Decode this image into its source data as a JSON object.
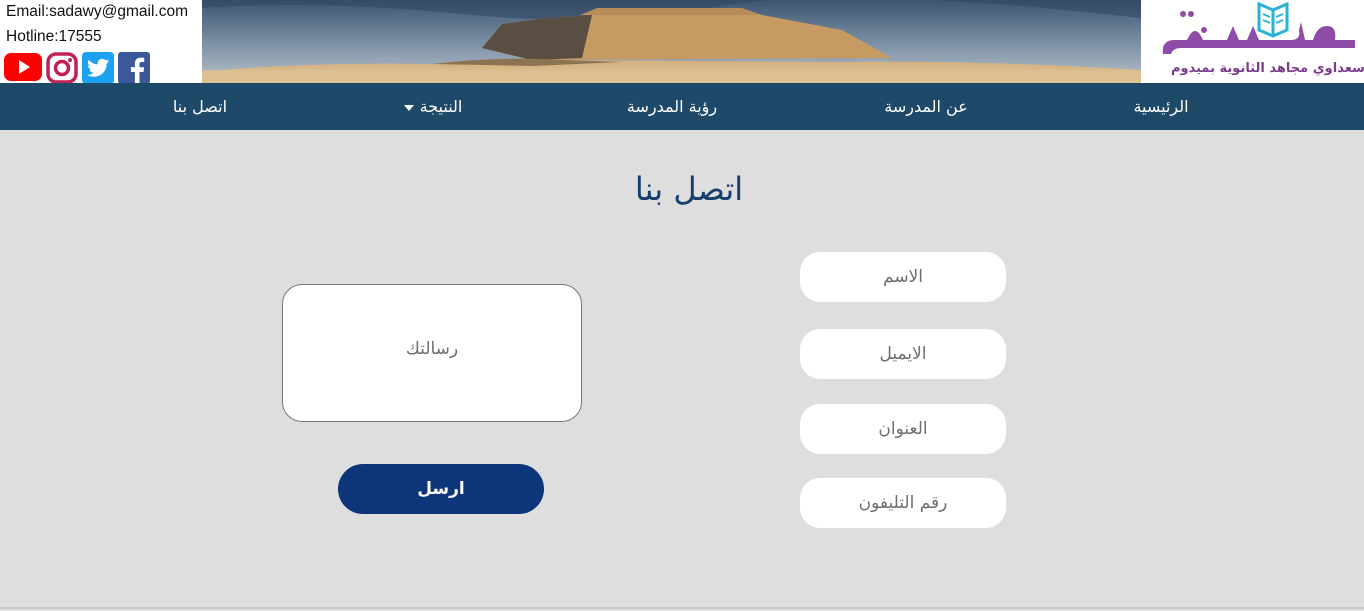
{
  "header": {
    "email": "Email:sadawy@gmail.com",
    "hotline": "Hotline:17555",
    "socials": [
      {
        "name": "youtube",
        "color": "#ff0000"
      },
      {
        "name": "instagram",
        "color": "#c1215a"
      },
      {
        "name": "twitter",
        "color": "#1da1f2"
      },
      {
        "name": "facebook",
        "color": "#3b5998"
      }
    ],
    "logo": {
      "subtitle": "سعداوي مجاهد الثانوية بميدوم",
      "color_main": "#8e4ba8",
      "color_book": "#2ab3d6"
    }
  },
  "nav": {
    "items": [
      {
        "label": "الرئيسية"
      },
      {
        "label": "عن المدرسة"
      },
      {
        "label": "رؤية المدرسة"
      },
      {
        "label": "النتيجة"
      },
      {
        "label": "اتصل بنا"
      }
    ],
    "bg_color": "#1f4968"
  },
  "main": {
    "title": "اتصل بنا",
    "fields": {
      "name_placeholder": "الاسم",
      "email_placeholder": "الايميل",
      "address_placeholder": "العنوان",
      "phone_placeholder": "رقم التليفون",
      "message_placeholder": "رسالتك"
    },
    "send_label": "ارسل",
    "accent_color": "#0c357a"
  }
}
